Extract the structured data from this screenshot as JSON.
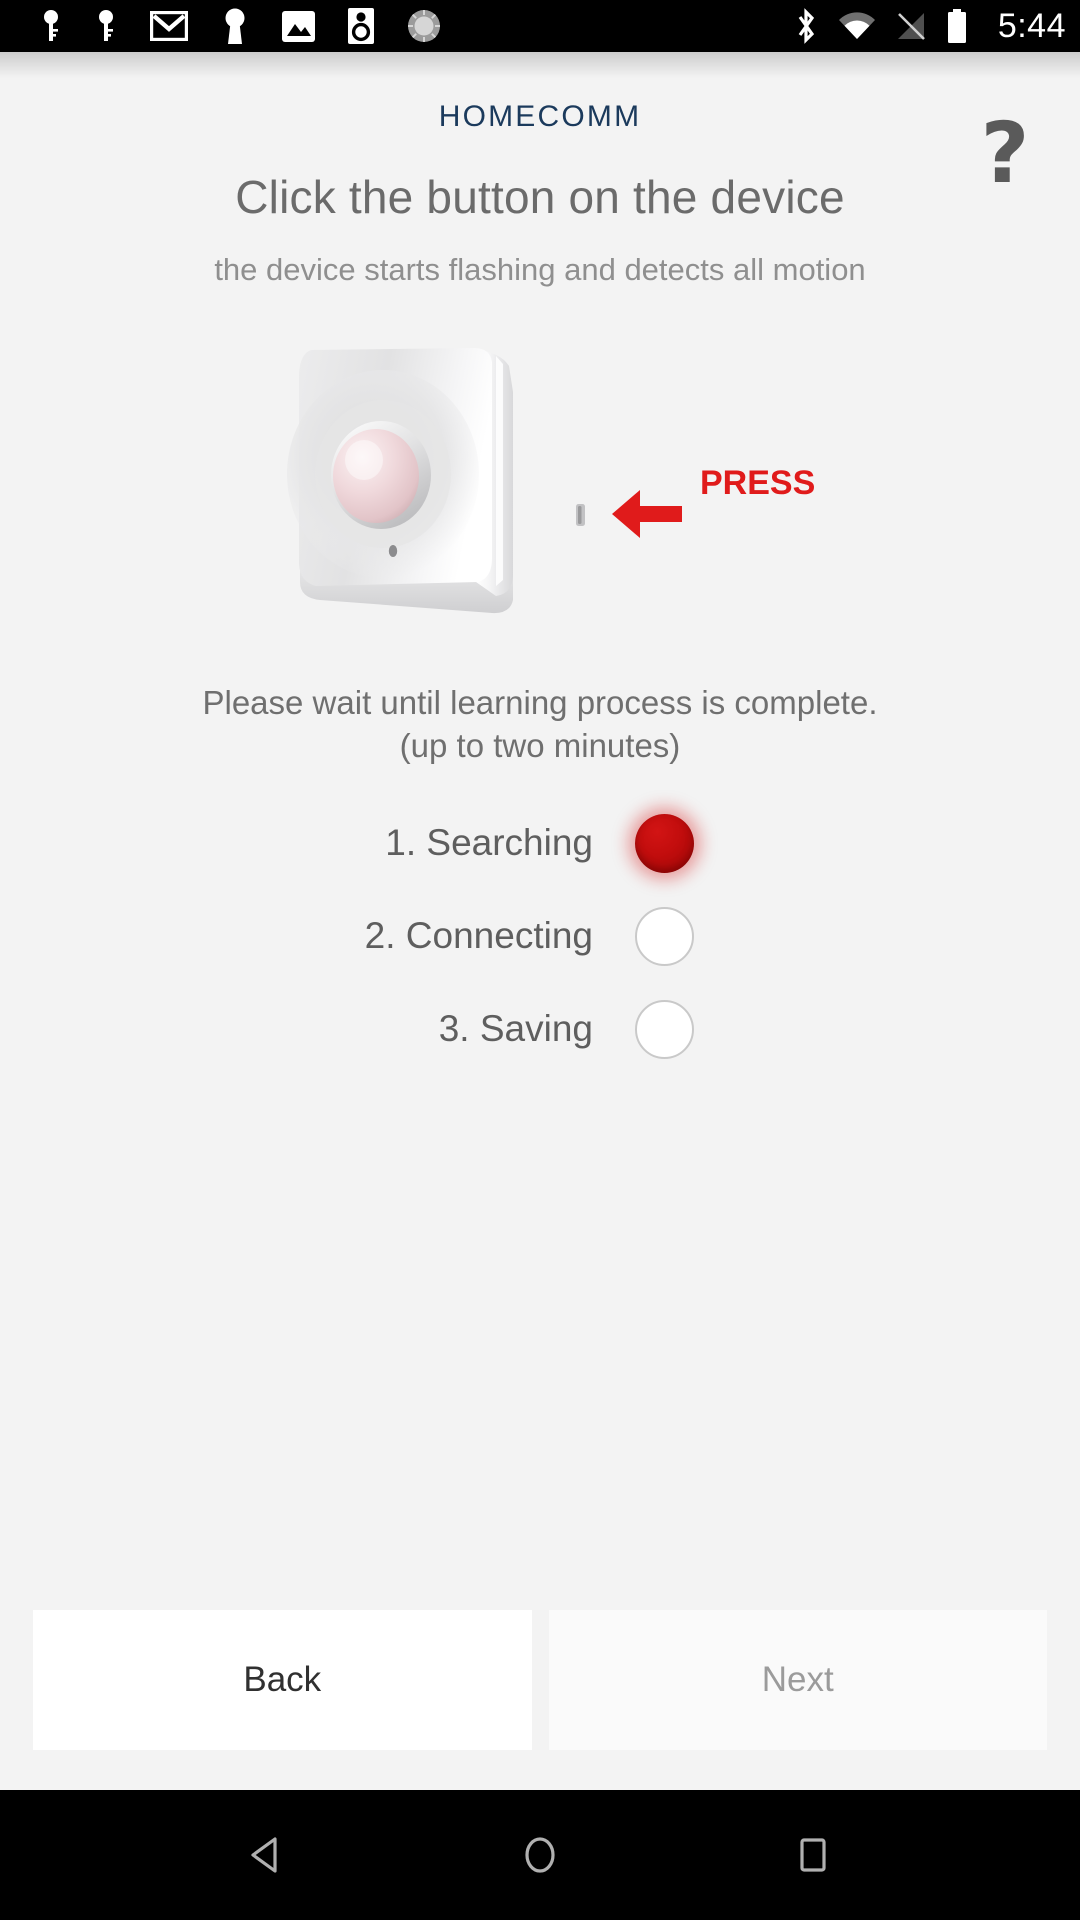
{
  "status_bar": {
    "clock": "5:44",
    "left_icons": [
      {
        "name": "key-icon-1"
      },
      {
        "name": "key-icon-2"
      },
      {
        "name": "gmail-icon"
      },
      {
        "name": "keyhole-icon"
      },
      {
        "name": "photos-icon"
      },
      {
        "name": "speaker-icon"
      },
      {
        "name": "dial-icon"
      }
    ],
    "right_icons": [
      {
        "name": "bluetooth-icon"
      },
      {
        "name": "wifi-icon"
      },
      {
        "name": "signal-off-icon"
      },
      {
        "name": "battery-icon"
      }
    ]
  },
  "header": {
    "app_title": "HOMECOMM",
    "help_glyph": "?"
  },
  "main": {
    "headline": "Click the button on the device",
    "subhead": "the device starts flashing and detects all motion",
    "device_callout": "PRESS",
    "wait_line_1": "Please wait until learning process is complete.",
    "wait_line_2": "(up to two minutes)"
  },
  "steps": [
    {
      "label": "1. Searching",
      "state": "on"
    },
    {
      "label": "2. Connecting",
      "state": "off"
    },
    {
      "label": "3. Saving",
      "state": "off"
    }
  ],
  "footer": {
    "back_label": "Back",
    "next_label": "Next"
  },
  "nav_bar": {
    "back": "nav-back-icon",
    "home": "nav-home-icon",
    "recents": "nav-recents-icon"
  },
  "colors": {
    "app_title": "#1b3a5c",
    "headline": "#6b6b6b",
    "callout_red": "#d81f1f",
    "led_active": "#c20d0d",
    "background": "#f3f3f3"
  }
}
